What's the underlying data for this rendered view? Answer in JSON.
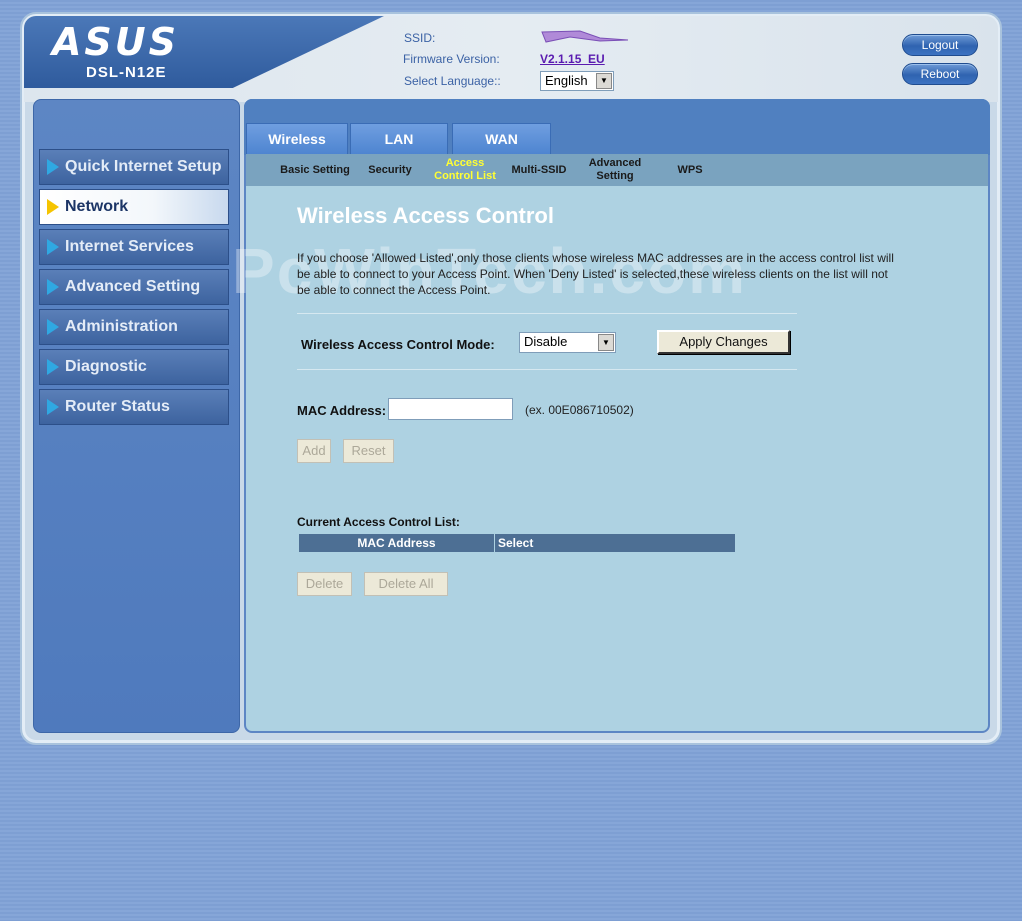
{
  "header": {
    "logo": "ASUS",
    "model": "DSL-N12E",
    "ssid_label": "SSID:",
    "firmware_label": "Firmware Version:",
    "firmware_value": "V2.1.15_EU",
    "language_label": "Select Language::",
    "language_value": "English",
    "logout_label": "Logout",
    "reboot_label": "Reboot"
  },
  "sidebar": {
    "items": [
      {
        "label": "Quick Internet Setup"
      },
      {
        "label": "Network"
      },
      {
        "label": "Internet Services"
      },
      {
        "label": "Advanced Setting"
      },
      {
        "label": "Administration"
      },
      {
        "label": "Diagnostic"
      },
      {
        "label": "Router Status"
      }
    ],
    "active": "Network"
  },
  "tabs": [
    {
      "label": "Wireless"
    },
    {
      "label": "LAN"
    },
    {
      "label": "WAN"
    }
  ],
  "subnav": [
    {
      "label": "Basic Setting"
    },
    {
      "label": "Security"
    },
    {
      "label": "Access Control List"
    },
    {
      "label": "Multi-SSID"
    },
    {
      "label": "Advanced Setting"
    },
    {
      "label": "WPS"
    }
  ],
  "main": {
    "title": "Wireless Access Control",
    "description": "If you choose 'Allowed Listed',only those clients whose wireless MAC addresses are in the access control list will be able to connect to your Access Point. When 'Deny Listed' is selected,these wireless clients on the list will not be able to connect the Access Point.",
    "watermark": "PcWinTech.com",
    "mode_label": "Wireless Access Control Mode:",
    "mode_value": "Disable",
    "apply_label": "Apply Changes",
    "mac_label": "MAC Address:",
    "mac_value": "",
    "mac_hint": "(ex. 00E086710502)",
    "add_label": "Add",
    "reset_label": "Reset",
    "list_title": "Current Access Control List:",
    "table_headers": [
      "MAC Address",
      "Select"
    ],
    "delete_label": "Delete",
    "delete_all_label": "Delete All"
  }
}
